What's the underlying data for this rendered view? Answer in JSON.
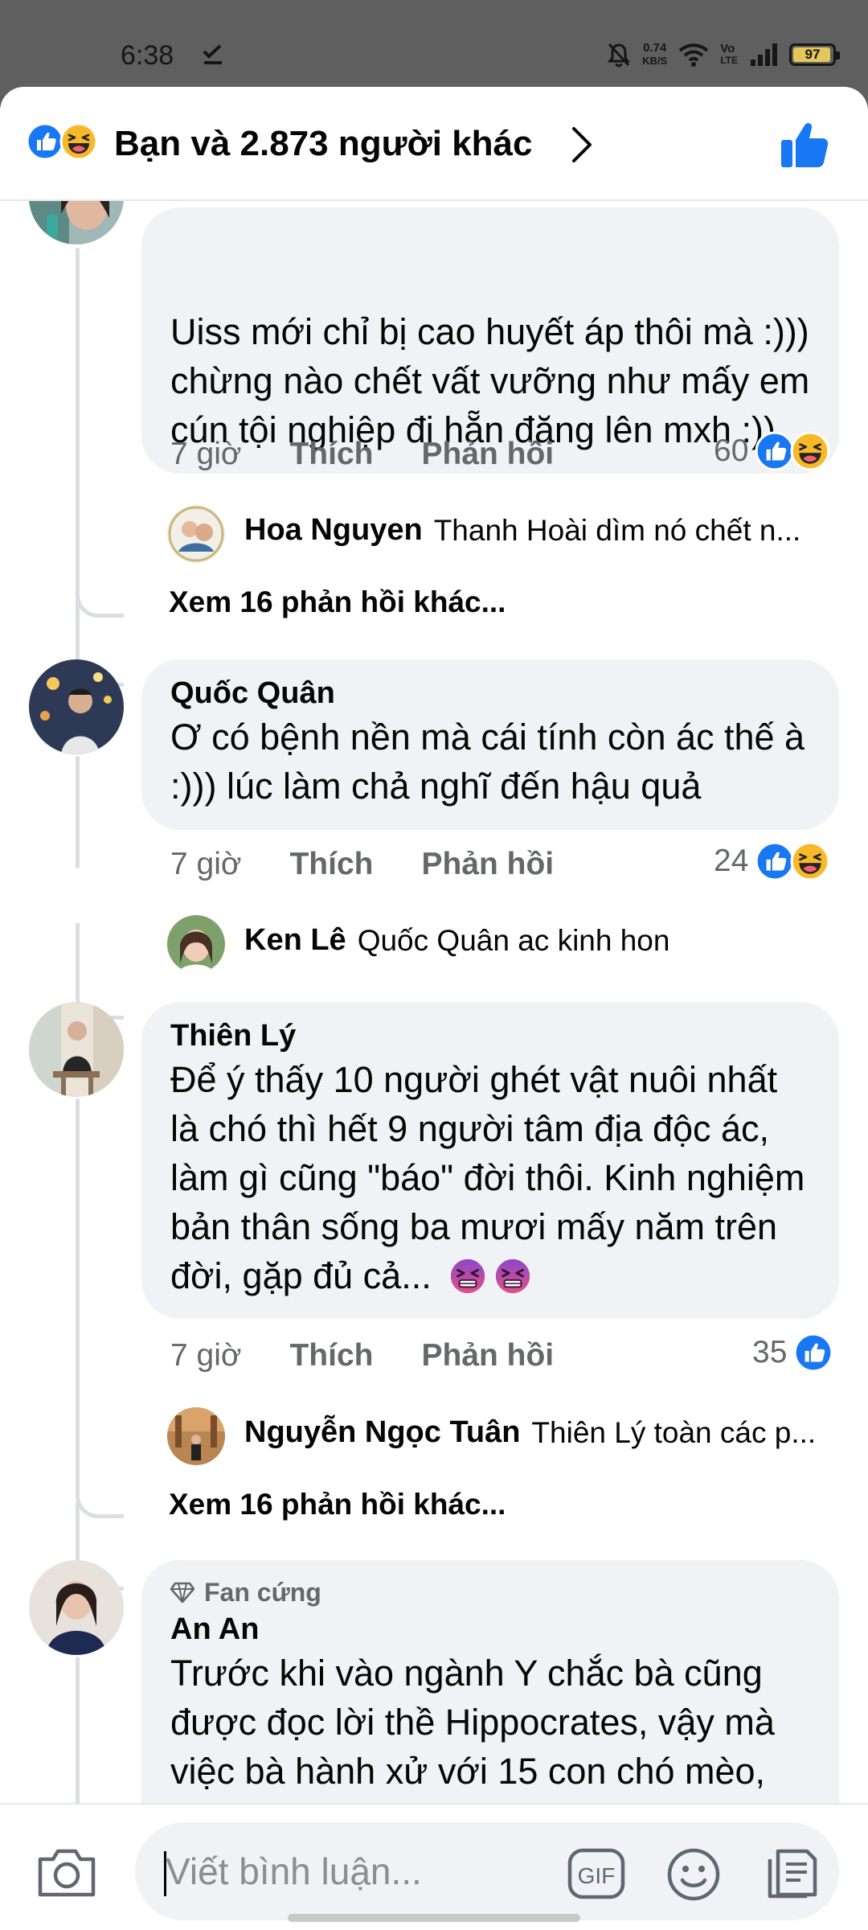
{
  "status_bar": {
    "time": "6:38",
    "speed_value": "0.74",
    "speed_unit": "KB/S",
    "volte_top": "Vo",
    "volte_bottom": "LTE",
    "battery": "97",
    "battery_level": 0.97
  },
  "header": {
    "reactions_text": "Bạn và 2.873 người khác",
    "reactions": [
      "like-icon",
      "haha-icon"
    ]
  },
  "comments": [
    {
      "id": "c0",
      "author": "",
      "text": "Uiss mới chỉ bị cao huyết áp thôi mà :))) chừng nào chết vất vưỡng như mấy em cún tội nghiệp đi hẵn đăng lên mxh :))",
      "time": "7 giờ",
      "like_label": "Thích",
      "reply_label": "Phản hồi",
      "reaction_count": "60",
      "reactions": [
        "like-icon",
        "haha-icon"
      ],
      "reply": {
        "author": "Hoa Nguyen",
        "text": "Thanh Hoài dìm nó chết n..."
      },
      "more_replies": "Xem 16 phản hồi khác..."
    },
    {
      "id": "c1",
      "author": "Quốc Quân",
      "text": "Ơ có bệnh nền mà cái tính còn ác thế à :))) lúc làm chả nghĩ đến hậu quả",
      "time": "7 giờ",
      "like_label": "Thích",
      "reply_label": "Phản hồi",
      "reaction_count": "24",
      "reactions": [
        "like-icon",
        "haha-icon"
      ],
      "reply": {
        "author": "Ken Lê",
        "text": "Quốc Quân ac kinh hon"
      }
    },
    {
      "id": "c2",
      "author": "Thiên Lý",
      "text": "Để ý thấy 10 người ghét vật nuôi nhất là chó thì hết 9 người tâm địa độc ác, làm gì cũng \"báo\" đời thôi. Kinh nghiệm bản thân sống ba mươi mấy năm trên đời,  gặp đủ cả...",
      "time": "7 giờ",
      "like_label": "Thích",
      "reply_label": "Phản hồi",
      "reaction_count": "35",
      "reactions": [
        "like-icon"
      ],
      "reply": {
        "author": "Nguyễn Ngọc Tuân",
        "text": "Thiên Lý toàn các p..."
      },
      "more_replies": "Xem 16 phản hồi khác..."
    },
    {
      "id": "c3",
      "badge": "Fan cứng",
      "author": "An An",
      "text": "Trước khi vào ngành Y chắc bà cũng được đọc lời thề Hippocrates, vậy mà việc bà hành xử với 15 con chó mèo,"
    }
  ],
  "composer": {
    "placeholder": "Viết bình luận...",
    "gif_label": "GIF"
  },
  "colors": {
    "like_blue": "#1877f2",
    "haha_yellow": "#f7b928",
    "bubble_bg": "#f0f2f5",
    "meta_gray": "#65676b"
  }
}
